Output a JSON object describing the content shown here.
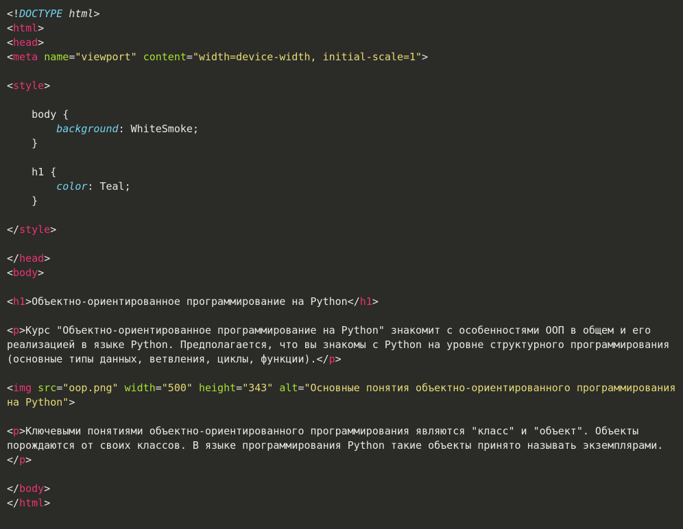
{
  "code": {
    "doctype": {
      "open": "<!",
      "kw": "DOCTYPE",
      "html": "html",
      "close": ">"
    },
    "html_open": "html",
    "head_open": "head",
    "meta": {
      "tag": "meta",
      "name_attr": "name",
      "name_val": "\"viewport\"",
      "content_attr": "content",
      "content_val": "\"width=device-width, initial-scale=1\""
    },
    "style_open": "style",
    "css": {
      "body_sel": "body",
      "body_brace_open": "{",
      "body_prop": "background",
      "body_val": "WhiteSmoke",
      "body_brace_close": "}",
      "h1_sel": "h1",
      "h1_brace_open": "{",
      "h1_prop": "color",
      "h1_val": "Teal",
      "h1_brace_close": "}"
    },
    "style_close": "style",
    "head_close": "head",
    "body_open": "body",
    "h1": {
      "tag": "h1",
      "text": "Объектно-ориентированное программирование на Python"
    },
    "p1": {
      "tag": "p",
      "text": "Курс \"Объектно-ориентированное программирование на Python\" знакомит с особенностями ООП в общем и его реализацией в языке Python. Предполагается, что вы знакомы с Python на уровне структурного программирования (основные типы данных, ветвления, циклы, функции)."
    },
    "img": {
      "tag": "img",
      "src_attr": "src",
      "src_val": "\"oop.png\"",
      "width_attr": "width",
      "width_val": "\"500\"",
      "height_attr": "height",
      "height_val": "\"343\"",
      "alt_attr": "alt",
      "alt_val": "\"Основные понятия объектно-ориентированного программирования на Python\""
    },
    "p2": {
      "tag": "p",
      "text": "Ключевыми понятиями объектно-ориентированного программирования являются \"класс\" и \"объект\". Объекты порождаются от своих классов. В языке программирования Python такие объекты принято называть экземплярами."
    },
    "body_close": "body",
    "html_close": "html"
  }
}
